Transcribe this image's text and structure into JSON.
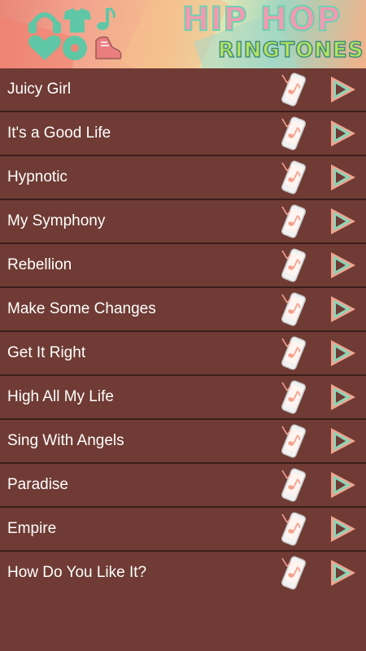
{
  "header": {
    "title_main": "HIP HOP",
    "title_sub": "RINGTONES",
    "icons": [
      "headphones-icon",
      "tshirt-icon",
      "music-note-icon",
      "heart-icon",
      "vinyl-record-icon",
      "sneaker-icon"
    ],
    "colors": {
      "icon_teal": "#5fc7a5",
      "icon_pink": "#e97e7f",
      "background": "#6f3b34",
      "divider": "#3b1e1b"
    }
  },
  "songs": [
    {
      "title": "Juicy Girl"
    },
    {
      "title": "It's a Good Life"
    },
    {
      "title": "Hypnotic"
    },
    {
      "title": "My Symphony"
    },
    {
      "title": "Rebellion"
    },
    {
      "title": "Make Some Changes"
    },
    {
      "title": "Get It Right"
    },
    {
      "title": "High All My Life"
    },
    {
      "title": "Sing With Angels"
    },
    {
      "title": "Paradise"
    },
    {
      "title": "Empire"
    },
    {
      "title": "How Do You Like It?"
    }
  ],
  "row_icons": {
    "set_ringtone": "set-ringtone-phone-icon",
    "play": "play-icon"
  }
}
